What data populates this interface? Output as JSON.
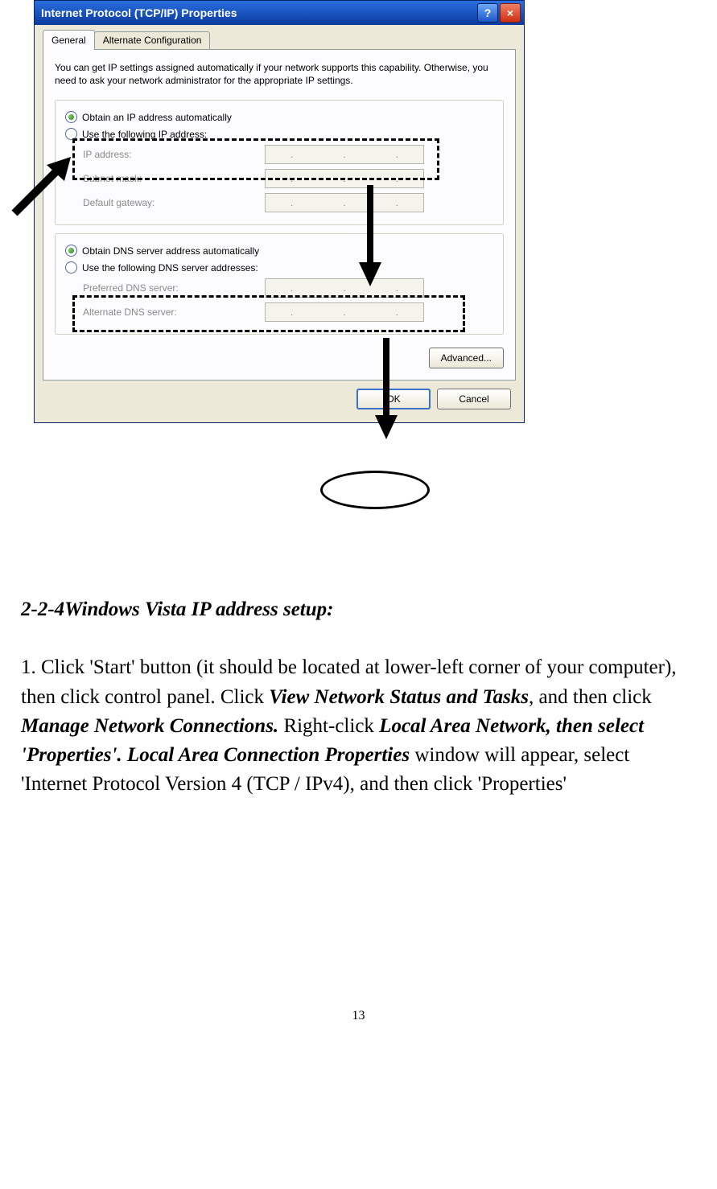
{
  "dialog": {
    "title": "Internet Protocol (TCP/IP) Properties",
    "tabs": {
      "general": "General",
      "alt": "Alternate Configuration"
    },
    "desc": "You can get IP settings assigned automatically if your network supports this capability. Otherwise, you need to ask your network administrator for the appropriate IP settings.",
    "ip": {
      "auto": "Obtain an IP address automatically",
      "manual": "Use the following IP address:",
      "ipaddr_label": "IP address:",
      "subnet_label": "Subnet mask:",
      "gateway_label": "Default gateway:"
    },
    "dns": {
      "auto": "Obtain DNS server address automatically",
      "manual": "Use the following DNS server addresses:",
      "pref_label": "Preferred DNS server:",
      "alt_label": "Alternate DNS server:"
    },
    "buttons": {
      "advanced": "Advanced...",
      "ok": "OK",
      "cancel": "Cancel"
    }
  },
  "doc": {
    "heading": "2-2-4Windows Vista IP address setup:",
    "step1_a": "1. Click 'Start' button (it should be located at lower-left corner of your computer), then click control panel. Click ",
    "step1_b": "View Network Status and Tasks",
    "step1_c": ", and then click ",
    "step1_d": "Manage Network Connections.",
    "step1_e": " Right-click ",
    "step1_f": "Local Area Network, then select 'Properties'. Local Area Connection Properties",
    "step1_g": " window will appear, select 'Internet Protocol Version 4 (TCP / IPv4), and then click 'Properties'"
  },
  "page_number": "13"
}
